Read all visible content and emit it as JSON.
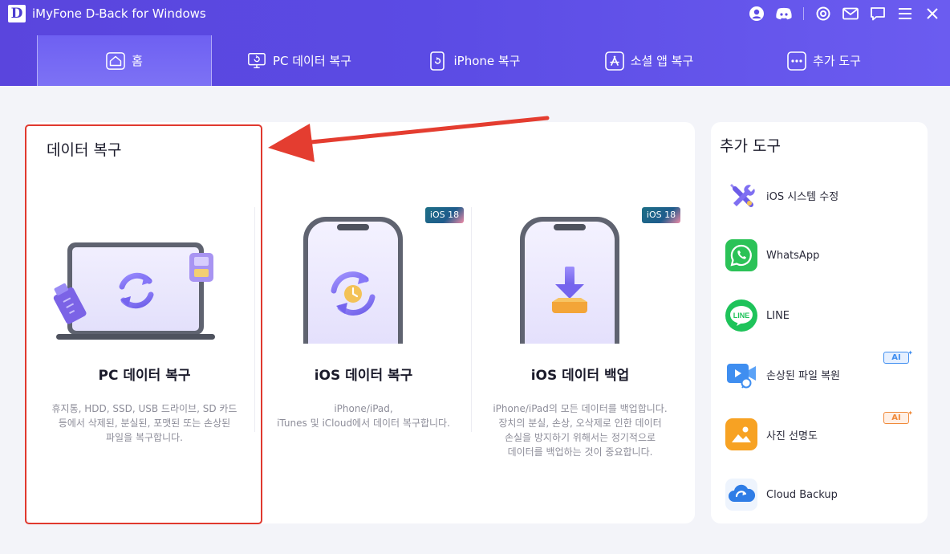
{
  "app": {
    "logo_letter": "D",
    "title": "iMyFone D-Back for Windows"
  },
  "titlebar_icons": [
    "user-icon",
    "discord-icon",
    "settings-icon",
    "mail-icon",
    "chat-icon",
    "menu-icon",
    "close-icon"
  ],
  "tabs": [
    {
      "label": "홈",
      "icon": "home-icon",
      "active": true
    },
    {
      "label": "PC 데이터 복구",
      "icon": "pc-recovery-icon",
      "active": false
    },
    {
      "label": "iPhone 복구",
      "icon": "iphone-icon",
      "active": false
    },
    {
      "label": "소셜 앱 복구",
      "icon": "app-store-icon",
      "active": false
    },
    {
      "label": "추가 도구",
      "icon": "more-icon",
      "active": false
    }
  ],
  "main": {
    "section_title": "데이터 복구",
    "features": [
      {
        "name": "PC 데이터 복구",
        "desc": "휴지통, HDD, SSD, USB 드라이브, SD 카드\n등에서 삭제된, 분실된, 포맷된 또는 손상된\n파일을 복구합니다."
      },
      {
        "name": "iOS 데이터 복구",
        "badge": "iOS 18",
        "desc": "iPhone/iPad,\niTunes 및 iCloud에서 데이터 복구합니다."
      },
      {
        "name": "iOS 데이터 백업",
        "badge": "iOS 18",
        "desc": "iPhone/iPad의 모든 데이터를 백업합니다.\n장치의 분실, 손상, 오삭제로 인한 데이터\n손실을 방지하기 위해서는 정기적으로\n데이터를 백업하는 것이 중요합니다."
      }
    ]
  },
  "side": {
    "title": "추가 도구",
    "tools": [
      {
        "label": "iOS 시스템 수정",
        "icon": "repair-tools-icon"
      },
      {
        "label": "WhatsApp",
        "icon": "whatsapp-icon"
      },
      {
        "label": "LINE",
        "icon": "line-icon"
      },
      {
        "label": "손상된 파일 복원",
        "icon": "video-repair-icon",
        "badge": "AI"
      },
      {
        "label": "사진 선명도",
        "icon": "photo-enhance-icon",
        "badge": "AI"
      },
      {
        "label": "Cloud Backup",
        "icon": "cloud-backup-icon"
      }
    ]
  },
  "colors": {
    "header": "#5b4be4",
    "accent": "#7b6cf6",
    "highlight": "#e0392f"
  }
}
